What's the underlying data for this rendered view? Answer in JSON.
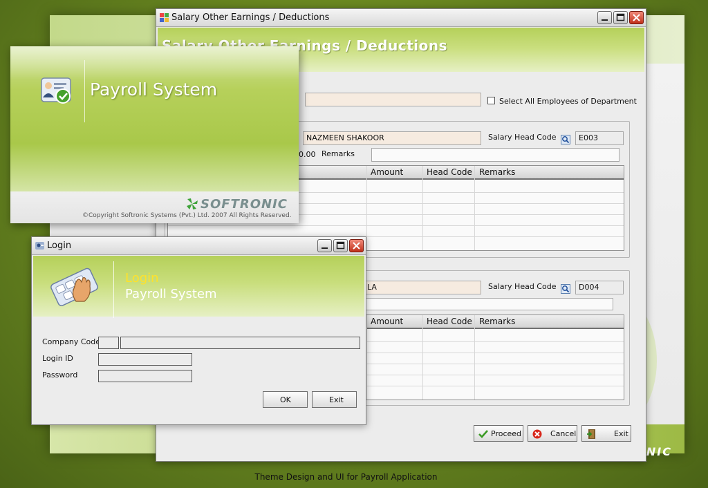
{
  "colors": {
    "brand_green": "#a9c84a",
    "login_title_yellow": "#ffe22b",
    "field_fill": "#f6ebe0"
  },
  "back": {
    "brand": "NIC"
  },
  "salary_window": {
    "title": "Salary Other Earnings / Deductions",
    "heading": "Salary Other Earnings / Deductions",
    "select_all_label": "Select All Employees of Department",
    "earnings": {
      "employee_name": "NAZMEEN SHAKOOR",
      "salary_head_label": "Salary Head Code",
      "salary_head_code": "E003",
      "amount_value": "0.00",
      "remarks_label": "Remarks",
      "columns": [
        "Amount",
        "Head Code",
        "Remarks"
      ]
    },
    "deductions": {
      "employee_name": "LA",
      "salary_head_label": "Salary Head Code",
      "salary_head_code": "D004",
      "columns": [
        "Amount",
        "Head Code",
        "Remarks"
      ]
    },
    "buttons": {
      "proceed": "Proceed",
      "cancel": "Cancel",
      "exit": "Exit"
    }
  },
  "splash": {
    "title": "Payroll System",
    "company": "SOFTRONIC",
    "copyright": "©Copyright Softronic Systems (Pvt.) Ltd. 2007 All Rights Reserved."
  },
  "login_window": {
    "title": "Login",
    "heading_line1": "Login",
    "heading_line2": "Payroll System",
    "company_code_label": "Company Code",
    "login_id_label": "Login ID",
    "password_label": "Password",
    "ok": "OK",
    "exit": "Exit"
  },
  "caption": "Theme Design and UI for Payroll Application"
}
